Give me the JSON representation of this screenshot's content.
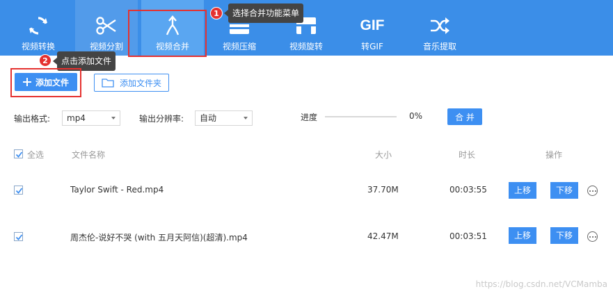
{
  "toolbar": {
    "items": [
      {
        "label": "视频转换",
        "icon": "refresh-icon"
      },
      {
        "label": "视频分割",
        "icon": "scissors-icon"
      },
      {
        "label": "视频合并",
        "icon": "merge-icon"
      },
      {
        "label": "视频压缩",
        "icon": "compress-icon"
      },
      {
        "label": "视频旋转",
        "icon": "rotate-icon"
      },
      {
        "label": "转GIF",
        "gif_text": "GIF",
        "icon": "gif-icon"
      },
      {
        "label": "音乐提取",
        "icon": "shuffle-icon"
      }
    ],
    "active": "视频合并",
    "color": "#3b8ee8"
  },
  "annotations": [
    {
      "number": "1",
      "text": "选择合并功能菜单"
    },
    {
      "number": "2",
      "text": "点击添加文件"
    }
  ],
  "actions": {
    "add_file": "添加文件",
    "add_folder": "添加文件夹"
  },
  "settings": {
    "format_label": "输出格式:",
    "format_value": "mp4",
    "resolution_label": "输出分辨率:",
    "resolution_value": "自动",
    "progress_label": "进度",
    "progress_value": "0%",
    "merge_button": "合 并"
  },
  "table": {
    "select_all": "全选",
    "columns": {
      "name": "文件名称",
      "size": "大小",
      "duration": "时长",
      "actions": "操作"
    },
    "rows": [
      {
        "name": "Taylor Swift - Red.mp4",
        "size": "37.70M",
        "duration": "00:03:55",
        "up": "上移",
        "down": "下移",
        "checked": true
      },
      {
        "name": "周杰伦-说好不哭 (with 五月天阿信)(超清).mp4",
        "size": "42.47M",
        "duration": "00:03:51",
        "up": "上移",
        "down": "下移",
        "checked": true
      }
    ]
  },
  "watermark": "https://blog.csdn.net/VCMamba",
  "colors": {
    "accent": "#3d8ff2",
    "highlight": "#e5312f"
  }
}
